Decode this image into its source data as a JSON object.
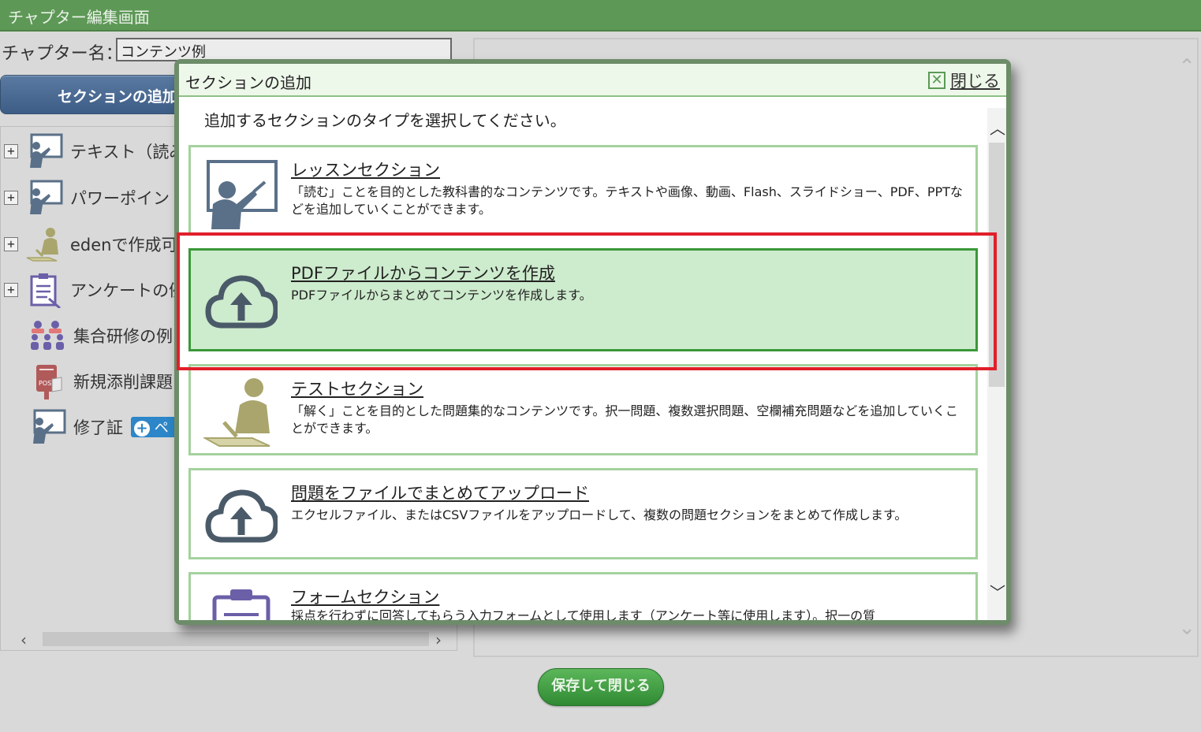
{
  "page": {
    "title": "チャプター編集画面",
    "chapter_name_label": "チャプター名：",
    "chapter_name_value": "コンテンツ例",
    "add_section_button": "セクションの追加",
    "save_button": "保存して閉じる"
  },
  "tree": {
    "items": [
      {
        "label": "テキスト（読み",
        "icon": "lecture-icon",
        "expandable": true
      },
      {
        "label": "パワーポイント",
        "icon": "lecture-icon",
        "expandable": true
      },
      {
        "label": "edenで作成可能",
        "icon": "test-writing-icon",
        "expandable": true
      },
      {
        "label": "アンケートの例",
        "icon": "survey-clipboard-icon",
        "expandable": true
      },
      {
        "label": "集合研修の例",
        "icon": "group-training-icon",
        "expandable": false
      },
      {
        "label": "新規添削課題",
        "icon": "post-box-icon",
        "expandable": false
      },
      {
        "label": "修了証",
        "icon": "lecture-icon",
        "expandable": false,
        "chip": "ペ"
      }
    ],
    "expand_symbol": "+"
  },
  "modal": {
    "title": "セクションの追加",
    "close_label": "閉じる",
    "instruction": "追加するセクションのタイプを選択してください。",
    "cards": [
      {
        "title": "レッスンセクション",
        "description": "「読む」ことを目的とした教科書的なコンテンツです。テキストや画像、動画、Flash、スライドショー、PDF、PPTなどを追加していくことができます。",
        "icon": "lesson-board-icon",
        "selected": false
      },
      {
        "title": "PDFファイルからコンテンツを作成",
        "description": "PDFファイルからまとめてコンテンツを作成します。",
        "icon": "cloud-upload-icon",
        "selected": true
      },
      {
        "title": "テストセクション",
        "description": "「解く」ことを目的とした問題集的なコンテンツです。択一問題、複数選択問題、空欄補充問題などを追加していくことができます。",
        "icon": "test-writing-icon",
        "selected": false
      },
      {
        "title": "問題をファイルでまとめてアップロード",
        "description": "エクセルファイル、またはCSVファイルをアップロードして、複数の問題セクションをまとめて作成します。",
        "icon": "cloud-upload-icon",
        "selected": false
      },
      {
        "title": "フォームセクション",
        "description": "採点を行わずに回答してもらう入力フォームとして使用します（アンケート等に使用します）。択一の質",
        "icon": "form-clipboard-icon",
        "selected": false
      }
    ]
  },
  "colors": {
    "header_green": "#5e9857",
    "selected_card_bg": "#cdebcd",
    "card_border": "#a4d29d",
    "highlight_red": "#e11f2a",
    "icon_slate": "#5a7088",
    "icon_olive": "#a9a56d",
    "icon_purple": "#6b5fa8"
  }
}
